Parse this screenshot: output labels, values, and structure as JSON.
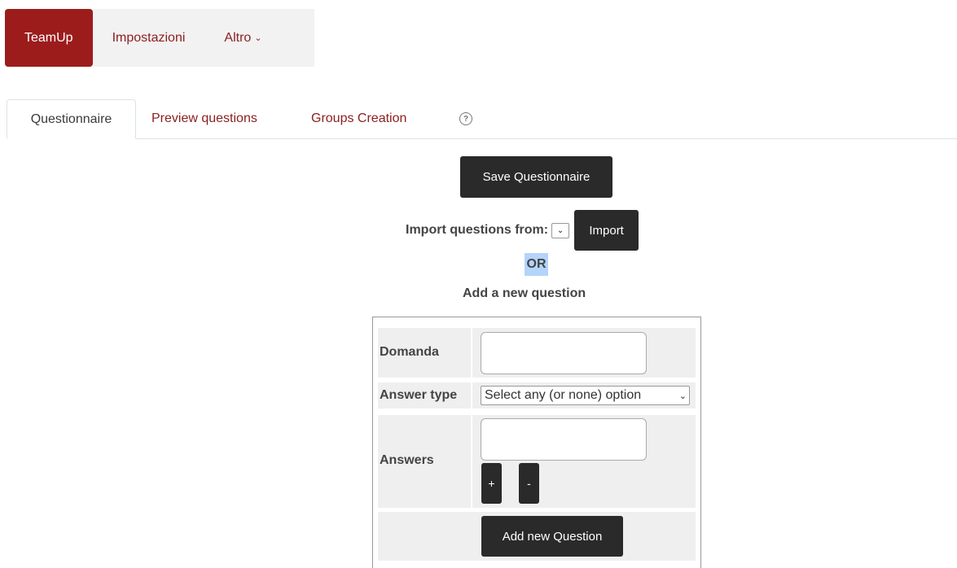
{
  "topnav": {
    "items": [
      {
        "label": "TeamUp"
      },
      {
        "label": "Impostazioni"
      },
      {
        "label": "Altro"
      }
    ],
    "caret": "⌄"
  },
  "tabs": {
    "questionnaire": "Questionnaire",
    "preview": "Preview questions",
    "groups": "Groups Creation",
    "help_glyph": "?"
  },
  "toolbar": {
    "save_label": "Save Questionnaire",
    "import_label": "Import questions from:",
    "import_select_glyph": "⌄",
    "import_button": "Import",
    "or": "OR",
    "add_new_title": "Add a new question"
  },
  "form": {
    "domanda_label": "Domanda",
    "domanda_value": "",
    "answer_type_label": "Answer type",
    "answer_type_value": "Select any (or none) option",
    "answers_label": "Answers",
    "answers_value": "",
    "plus_label": "+",
    "minus_label": "-",
    "add_question_label": "Add new Question"
  },
  "colors": {
    "brand": "#9c1c1c",
    "link": "#8c2020",
    "dark_button": "#2a2a2a",
    "highlight": "#b3d4fc"
  },
  "icons": [
    "help-icon",
    "chevron-down-icon"
  ]
}
